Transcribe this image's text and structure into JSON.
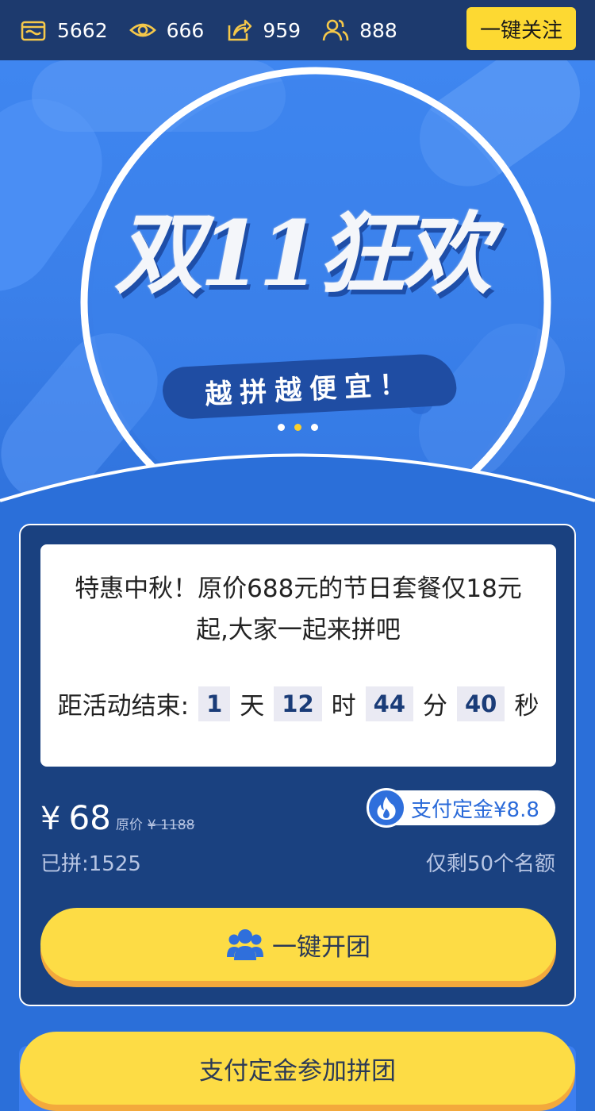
{
  "stats": {
    "shop_count": "5662",
    "views": "666",
    "shares": "959",
    "participants": "888"
  },
  "follow_button": "一键关注",
  "banner": {
    "headline": "双11狂欢",
    "slogan": "越拼越便宜！",
    "carousel_active_index": 1,
    "carousel_total": 3
  },
  "offer": {
    "description": "特惠中秋！原价688元的节日套餐仅18元起,大家一起来拼吧",
    "countdown_label": "距活动结束:",
    "countdown": {
      "days": "1",
      "days_unit": "天",
      "hours": "12",
      "hours_unit": "时",
      "minutes": "44",
      "minutes_unit": "分",
      "seconds": "40",
      "seconds_unit": "秒"
    },
    "price_symbol": "¥",
    "price": "68",
    "original_label": "原价",
    "original_price": "¥ 1188",
    "deposit_badge": "支付定金¥8.8",
    "joined": "已拼:1525",
    "remaining": "仅剩50个名额",
    "open_group_button": "一键开团"
  },
  "join_button": "支付定金参加拼团",
  "colors": {
    "top_bar": "#1d3a6e",
    "card_bg": "#1a4180",
    "accent_yellow": "#fddc45",
    "icon_gold": "#f5c84a",
    "banner_blue": "#3f86f0"
  }
}
